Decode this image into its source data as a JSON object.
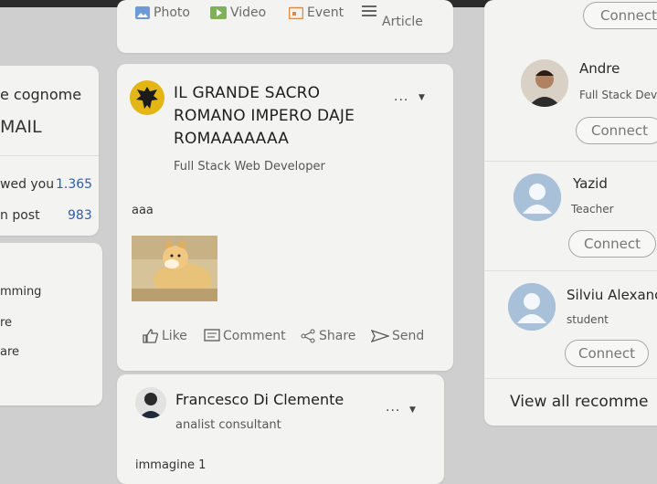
{
  "composer": {
    "photo": "Photo",
    "video": "Video",
    "event": "Event",
    "article": "Article"
  },
  "sidebar": {
    "name_partial": "e cognome",
    "email_partial": "MAIL",
    "viewed_label": "wed you",
    "viewed_count": "1.365",
    "post_label": "n post",
    "post_count": "983",
    "links": [
      "mming",
      "re",
      "are"
    ]
  },
  "post1": {
    "author": "IL GRANDE SACRO ROMANO IMPERO DAJE ROMAAAAAAA",
    "subtitle": "Full Stack Web Developer",
    "more": "...",
    "text": "aaa",
    "actions": {
      "like": "Like",
      "comment": "Comment",
      "share": "Share",
      "send": "Send"
    }
  },
  "post2": {
    "author": "Francesco Di Clemente",
    "subtitle": "analist consultant",
    "more": "...",
    "text": "immagine 1"
  },
  "suggestions": {
    "top_connect": "Connect",
    "people": [
      {
        "name": "Andre",
        "role": "Full Stack Deve",
        "button": "Connect"
      },
      {
        "name": "Yazid",
        "role": "Teacher",
        "button": "Connect"
      },
      {
        "name": "Silviu Alexanc",
        "role": "student",
        "button": "Connect"
      }
    ],
    "view_all": "View all recomme"
  }
}
